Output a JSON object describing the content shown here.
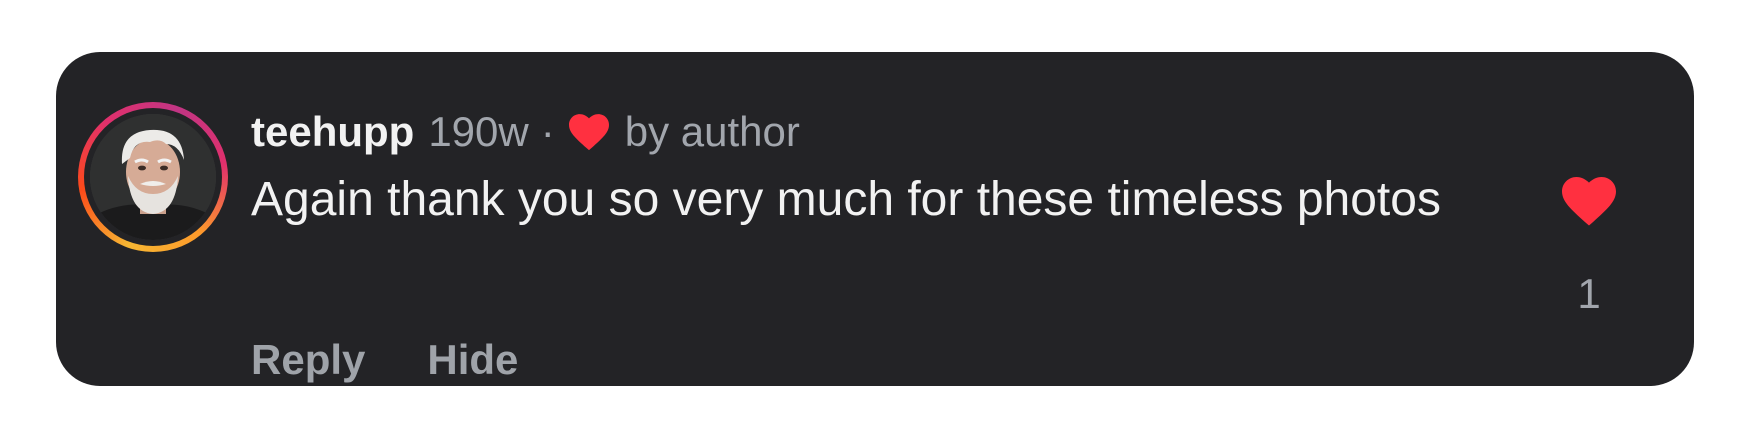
{
  "comment": {
    "username": "teehupp",
    "time": "190w",
    "separator": "·",
    "liked_by_author_label": "by author",
    "text": "Again thank you so very much for these timeless photos",
    "like_count": "1"
  },
  "actions": {
    "reply_label": "Reply",
    "hide_label": "Hide"
  },
  "icons": {
    "small_heart": "heart-icon",
    "like": "heart-icon",
    "avatar": "profile-photo"
  },
  "colors": {
    "card_background": "#232326",
    "heart": "#ff3040",
    "muted_text": "#a2a6ad",
    "primary_text": "#f2f2f2"
  }
}
